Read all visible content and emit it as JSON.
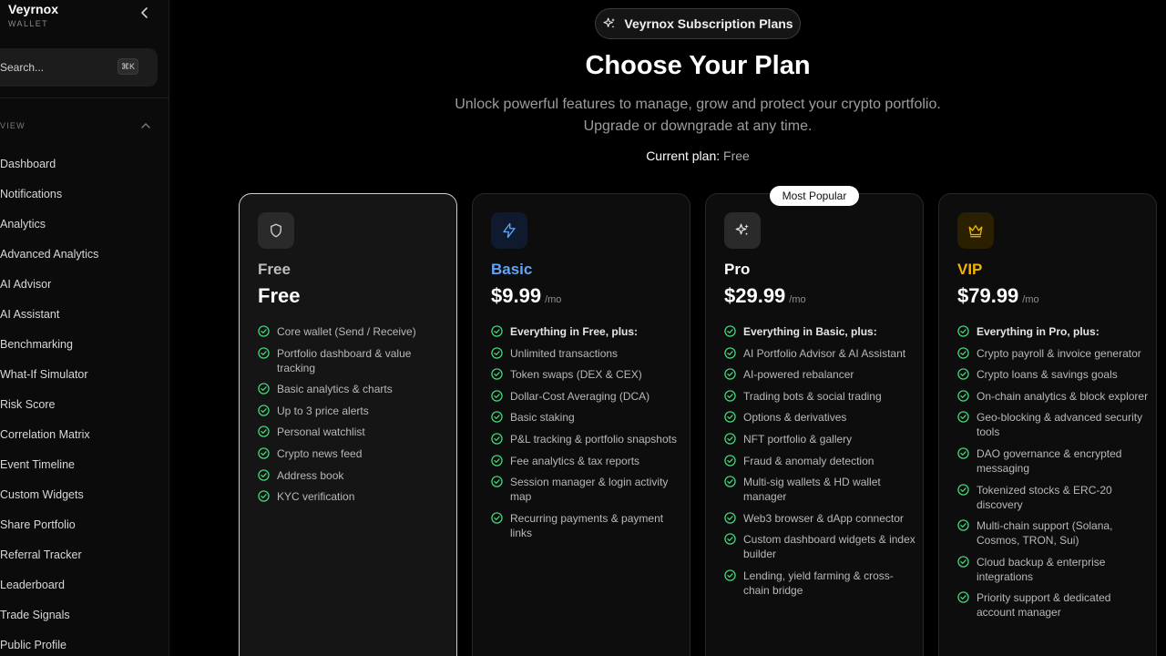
{
  "sidebar": {
    "brand_name": "Veyrnox",
    "brand_sub": "WALLET",
    "search_placeholder": "Search...",
    "search_shortcut": "⌘K",
    "section_label": "VIEW",
    "items": [
      {
        "label": "Dashboard"
      },
      {
        "label": "Notifications"
      },
      {
        "label": "Analytics"
      },
      {
        "label": "Advanced Analytics"
      },
      {
        "label": "AI Advisor"
      },
      {
        "label": "AI Assistant"
      },
      {
        "label": "Benchmarking"
      },
      {
        "label": "What-If Simulator"
      },
      {
        "label": "Risk Score"
      },
      {
        "label": "Correlation Matrix"
      },
      {
        "label": "Event Timeline"
      },
      {
        "label": "Custom Widgets"
      },
      {
        "label": "Share Portfolio"
      },
      {
        "label": "Referral Tracker"
      },
      {
        "label": "Leaderboard"
      },
      {
        "label": "Trade Signals"
      },
      {
        "label": "Public Profile"
      }
    ]
  },
  "header": {
    "pill_label": "Veyrnox Subscription Plans",
    "title": "Choose Your Plan",
    "subtitle_line1": "Unlock powerful features to manage, grow and protect your crypto portfolio.",
    "subtitle_line2": "Upgrade or downgrade at any time.",
    "current_label": "Current plan:",
    "current_value": "Free"
  },
  "badge": "Most Popular",
  "colors": {
    "check_green": "#4ade80",
    "basic_blue": "#60a5fa",
    "vip_gold": "#f5b301"
  },
  "plans": [
    {
      "name": "Free",
      "price": "Free",
      "per": "",
      "icon": "shield-icon",
      "features": [
        "Core wallet (Send / Receive)",
        "Portfolio dashboard & value tracking",
        "Basic analytics & charts",
        "Up to 3 price alerts",
        "Personal watchlist",
        "Crypto news feed",
        "Address book",
        "KYC verification"
      ]
    },
    {
      "name": "Basic",
      "price": "$9.99",
      "per": "/mo",
      "icon": "lightning-icon",
      "features": [
        "Everything in Free, plus:",
        "Unlimited transactions",
        "Token swaps (DEX & CEX)",
        "Dollar-Cost Averaging (DCA)",
        "Basic staking",
        "P&L tracking & portfolio snapshots",
        "Fee analytics & tax reports",
        "Session manager & login activity map",
        "Recurring payments & payment links"
      ]
    },
    {
      "name": "Pro",
      "price": "$29.99",
      "per": "/mo",
      "icon": "sparkles-icon",
      "features": [
        "Everything in Basic, plus:",
        "AI Portfolio Advisor & AI Assistant",
        "AI-powered rebalancer",
        "Trading bots & social trading",
        "Options & derivatives",
        "NFT portfolio & gallery",
        "Fraud & anomaly detection",
        "Multi-sig wallets & HD wallet manager",
        "Web3 browser & dApp connector",
        "Custom dashboard widgets & index builder",
        "Lending, yield farming & cross-chain bridge"
      ]
    },
    {
      "name": "VIP",
      "price": "$79.99",
      "per": "/mo",
      "icon": "crown-icon",
      "features": [
        "Everything in Pro, plus:",
        "Crypto payroll & invoice generator",
        "Crypto loans & savings goals",
        "On-chain analytics & block explorer",
        "Geo-blocking & advanced security tools",
        "DAO governance & encrypted messaging",
        "Tokenized stocks & ERC-20 discovery",
        "Multi-chain support (Solana, Cosmos, TRON, Sui)",
        "Cloud backup & enterprise integrations",
        "Priority support & dedicated account manager"
      ]
    }
  ]
}
